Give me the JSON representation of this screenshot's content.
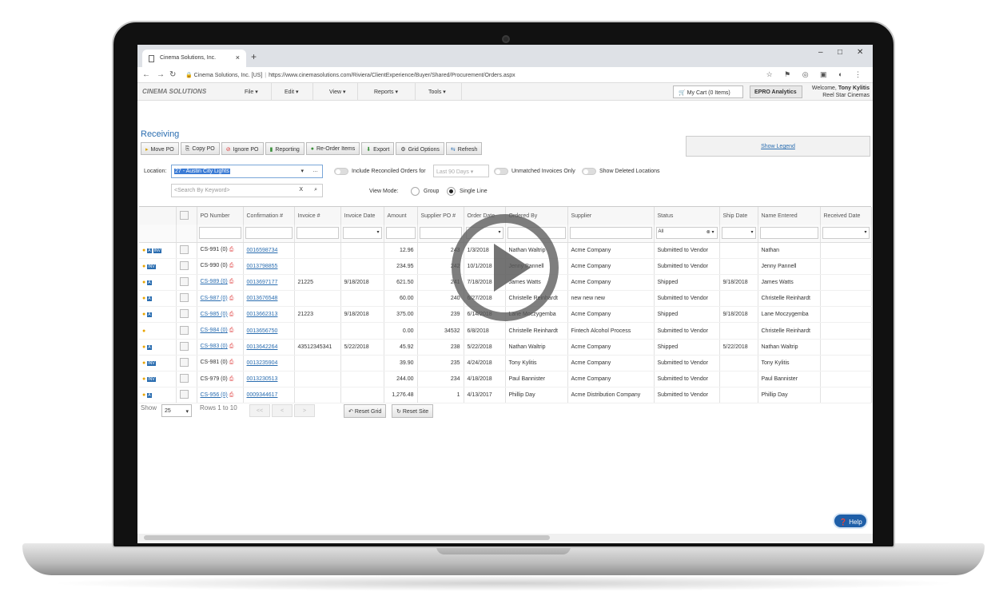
{
  "browser": {
    "tab_title": "Cinema Solutions, Inc.",
    "site_id": "Cinema Solutions, Inc. [US]",
    "url": "https://www.cinemasolutions.com/Riviera/ClientExperience/Buyer/Shared/Procurement/Orders.aspx"
  },
  "header": {
    "logo": "CINEMA SOLUTIONS",
    "menus": [
      "File",
      "Edit",
      "View",
      "Reports",
      "Tools"
    ],
    "cart": "My Cart (0 Items)",
    "analytics": "EPRO Analytics",
    "welcome_prefix": "Welcome,",
    "user": "Tony Kylitis",
    "company": "Reel Star Cinemas"
  },
  "page": {
    "title": "Receiving",
    "toolbar": [
      "Move PO",
      "Copy PO",
      "Ignore PO",
      "Reporting",
      "Re-Order Items",
      "Export",
      "Grid Options",
      "Refresh"
    ],
    "show_legend": "Show Legend"
  },
  "filters": {
    "location_label": "Location:",
    "location_value": "27 - Austin City Lights",
    "search_placeholder": "<Search By Keyword>",
    "include_reconciled": "Include Reconciled Orders for",
    "days_value": "Last 90 Days",
    "unmatched": "Unmatched Invoices Only",
    "show_deleted": "Show Deleted Locations",
    "view_mode_label": "View Mode:",
    "view_group": "Group",
    "view_single": "Single Line",
    "status_filter": "All"
  },
  "grid": {
    "columns": [
      "PO Number",
      "Confirmation #",
      "Invoice #",
      "Invoice Date",
      "Amount",
      "Supplier PO #",
      "Order Date",
      "Ordered By",
      "Supplier",
      "Status",
      "Ship Date",
      "Name Entered",
      "Received Date"
    ],
    "rows": [
      {
        "po": "CS-991 (0)",
        "po_link": false,
        "conf": "0016598734",
        "inv": "",
        "inv_date": "",
        "amount": "12.96",
        "sup_po": "243",
        "order_date": "1/3/2018",
        "ordered_by": "Nathan Waltrip",
        "supplier": "Acme Company",
        "status": "Submitted to Vendor",
        "ship_date": "",
        "name": "Nathan",
        "badges": [
          "A",
          "INV"
        ]
      },
      {
        "po": "CS-990 (0)",
        "po_link": false,
        "conf": "0013798855",
        "inv": "",
        "inv_date": "",
        "amount": "234.95",
        "sup_po": "242",
        "order_date": "10/1/2018",
        "ordered_by": "Jenny Pannell",
        "supplier": "Acme Company",
        "status": "Submitted to Vendor",
        "ship_date": "",
        "name": "Jenny Pannell",
        "badges": [
          "INV"
        ]
      },
      {
        "po": "CS-989 (0)",
        "po_link": true,
        "conf": "0013697177",
        "inv": "21225",
        "inv_date": "9/18/2018",
        "amount": "621.50",
        "sup_po": "241",
        "order_date": "7/18/2018",
        "ordered_by": "James Watts",
        "supplier": "Acme Company",
        "status": "Shipped",
        "ship_date": "9/18/2018",
        "name": "James Watts",
        "badges": [
          "A"
        ]
      },
      {
        "po": "CS-987 (0)",
        "po_link": true,
        "conf": "0013676548",
        "inv": "",
        "inv_date": "",
        "amount": "60.00",
        "sup_po": "240",
        "order_date": "6/27/2018",
        "ordered_by": "Christelle Reinhardt",
        "supplier": "new new new",
        "status": "Submitted to Vendor",
        "ship_date": "",
        "name": "Christelle Reinhardt",
        "badges": [
          "A"
        ]
      },
      {
        "po": "CS-985 (0)",
        "po_link": true,
        "conf": "0013662313",
        "inv": "21223",
        "inv_date": "9/18/2018",
        "amount": "375.00",
        "sup_po": "239",
        "order_date": "6/14/2018",
        "ordered_by": "Lane Moczygemba",
        "supplier": "Acme Company",
        "status": "Shipped",
        "ship_date": "9/18/2018",
        "name": "Lane Moczygemba",
        "badges": [
          "A"
        ]
      },
      {
        "po": "CS-984 (0)",
        "po_link": true,
        "conf": "0013656750",
        "inv": "",
        "inv_date": "",
        "amount": "0.00",
        "sup_po": "34532",
        "order_date": "6/8/2018",
        "ordered_by": "Christelle Reinhardt",
        "supplier": "Fintech Alcohol Process",
        "status": "Submitted to Vendor",
        "ship_date": "",
        "name": "Christelle Reinhardt",
        "badges": []
      },
      {
        "po": "CS-983 (0)",
        "po_link": true,
        "conf": "0013642264",
        "inv": "43512345341",
        "inv_date": "5/22/2018",
        "amount": "45.92",
        "sup_po": "238",
        "order_date": "5/22/2018",
        "ordered_by": "Nathan Waltrip",
        "supplier": "Acme Company",
        "status": "Shipped",
        "ship_date": "5/22/2018",
        "name": "Nathan Waltrip",
        "badges": [
          "A"
        ]
      },
      {
        "po": "CS-981 (0)",
        "po_link": false,
        "conf": "0013235904",
        "inv": "",
        "inv_date": "",
        "amount": "39.90",
        "sup_po": "235",
        "order_date": "4/24/2018",
        "ordered_by": "Tony Kylitis",
        "supplier": "Acme Company",
        "status": "Submitted to Vendor",
        "ship_date": "",
        "name": "Tony Kylitis",
        "badges": [
          "INV"
        ]
      },
      {
        "po": "CS-979 (0)",
        "po_link": false,
        "conf": "0013230513",
        "inv": "",
        "inv_date": "",
        "amount": "244.00",
        "sup_po": "234",
        "order_date": "4/18/2018",
        "ordered_by": "Paul Bannister",
        "supplier": "Acme Company",
        "status": "Submitted to Vendor",
        "ship_date": "",
        "name": "Paul Bannister",
        "badges": [
          "INV"
        ]
      },
      {
        "po": "CS-956 (0)",
        "po_link": true,
        "conf": "0009344617",
        "inv": "",
        "inv_date": "",
        "amount": "1,276.48",
        "sup_po": "1",
        "order_date": "4/13/2017",
        "ordered_by": "Phillip Day",
        "supplier": "Acme Distribution Company",
        "status": "Submitted to Vendor",
        "ship_date": "",
        "name": "Phillip Day",
        "badges": [
          "A"
        ]
      }
    ]
  },
  "pager": {
    "show": "Show",
    "page_size": "25",
    "rows_info": "Rows 1 to 10",
    "first": "<<",
    "prev": "<",
    "next": ">",
    "reset_grid": "Reset Grid",
    "reset_site": "Reset Site"
  },
  "help": "Help"
}
